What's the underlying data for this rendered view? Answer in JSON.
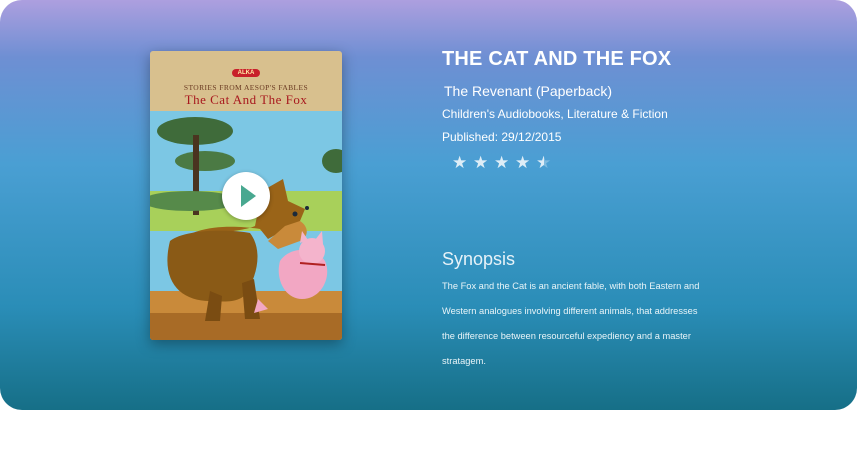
{
  "book": {
    "cover": {
      "logo": "ALKA",
      "series": "STORIES FROM AESOP'S FABLES",
      "title": "The Cat And The Fox"
    },
    "title": "THE CAT AND THE FOX",
    "subtitle": "The Revenant (Paperback)",
    "genre": "Children's Audiobooks, Literature & Fiction",
    "published": "Published: 29/12/2015",
    "rating": 4.5,
    "rating_max": 5,
    "star_glyphs": [
      "★",
      "★",
      "★",
      "★",
      "★"
    ]
  },
  "synopsis": {
    "heading": "Synopsis",
    "text": "The Fox and the Cat is an ancient fable, with both Eastern and Western analogues involving different animals, that addresses the difference between resourceful expediency and a master stratagem."
  },
  "icons": {
    "play": "play-icon",
    "star": "star-icon"
  },
  "colors": {
    "background_top": "#ad9fdf",
    "background_bottom": "#166f87",
    "play_accent": "#48a890"
  }
}
